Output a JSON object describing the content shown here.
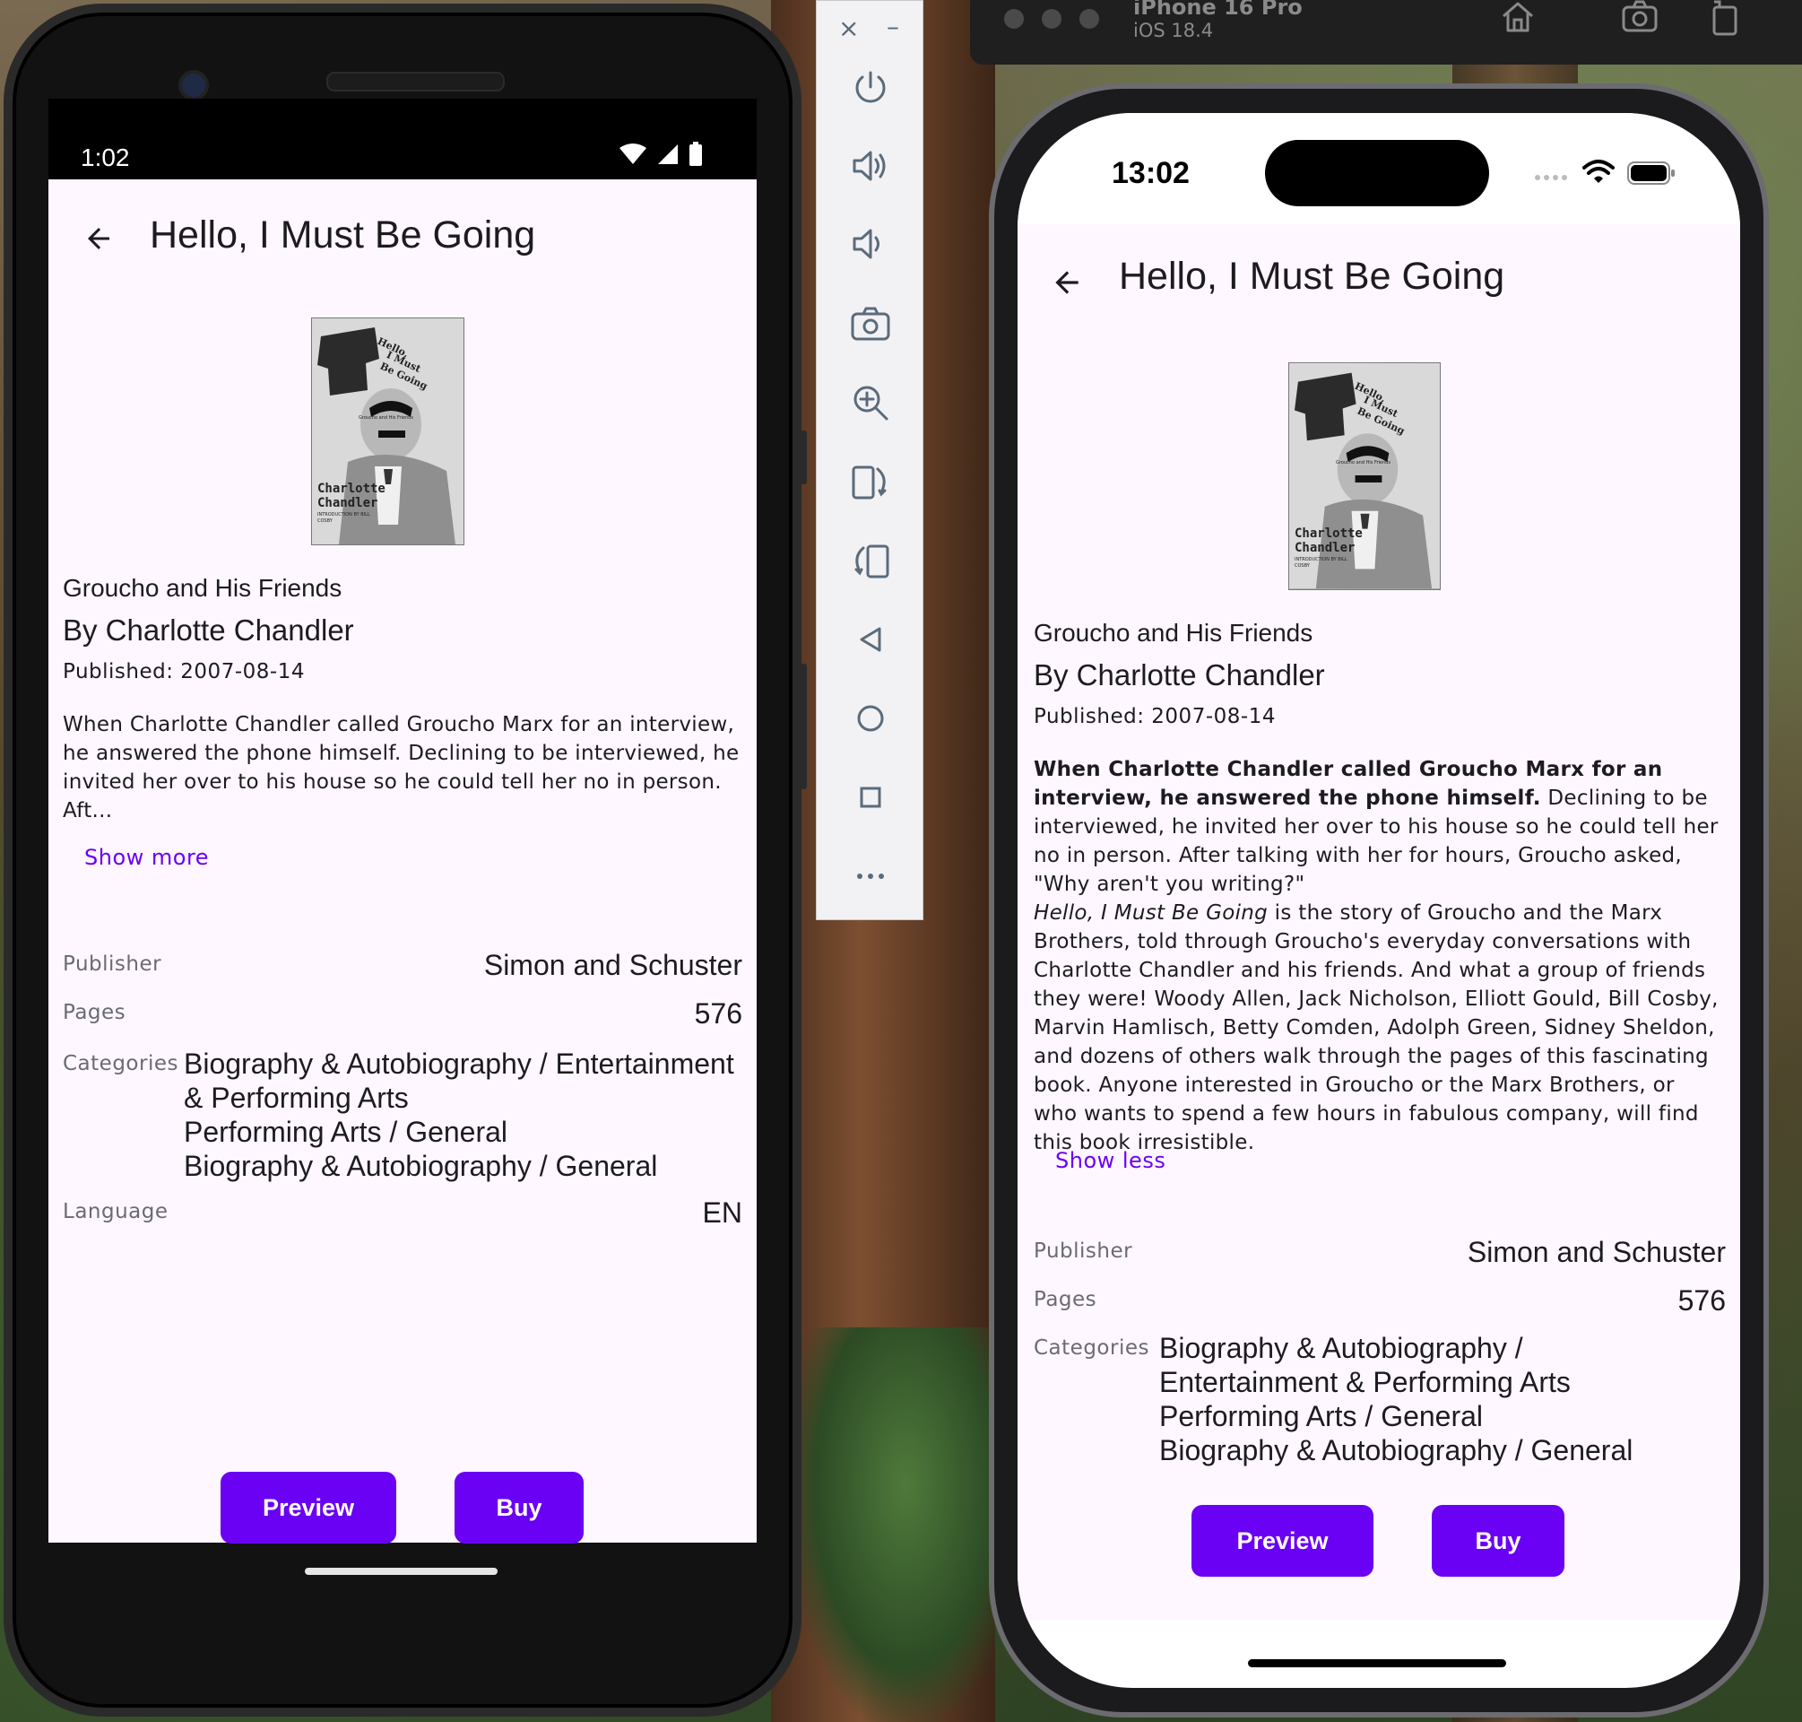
{
  "colors": {
    "accent": "#6a00f4",
    "screen_bg": "#fef7ff"
  },
  "android": {
    "status": {
      "time": "1:02"
    },
    "appbar": {
      "title": "Hello, I Must Be Going",
      "back_icon": "arrow-left-icon"
    },
    "book": {
      "subtitle": "Groucho and His Friends",
      "author": "By Charlotte Chandler",
      "published": "Published: 2007-08-14",
      "description": "When Charlotte Chandler called Groucho Marx for an interview, he answered the phone himself. Declining to be interviewed, he invited her over to his house so he could tell her no in person. Aft...",
      "toggle": "Show more"
    },
    "details": {
      "publisher_label": "Publisher",
      "publisher_value": "Simon and Schuster",
      "pages_label": "Pages",
      "pages_value": "576",
      "categories_label": "Categories",
      "categories_1": "Biography & Autobiography / Entertainment & Performing Arts",
      "categories_2": "Performing Arts / General",
      "categories_3": "Biography & Autobiography / General",
      "language_label": "Language",
      "language_value": "EN"
    },
    "buttons": {
      "preview": "Preview",
      "buy": "Buy"
    }
  },
  "emulator_toolbar": {
    "close": "×",
    "minimize": "–",
    "icons": [
      "power-icon",
      "volume-up-icon",
      "volume-down-icon",
      "camera-icon",
      "zoom-in-icon",
      "rotate-left-icon",
      "rotate-right-icon",
      "back-triangle-icon",
      "home-circle-icon",
      "overview-square-icon",
      "more-icon"
    ]
  },
  "simulator": {
    "title": "iPhone 16 Pro",
    "os": "iOS 18.4",
    "tools": [
      "home-icon",
      "screenshot-icon",
      "rotate-icon"
    ]
  },
  "iphone": {
    "status": {
      "time": "13:02"
    },
    "appbar": {
      "title": "Hello, I Must Be Going"
    },
    "book": {
      "subtitle": "Groucho and His Friends",
      "author": "By Charlotte Chandler",
      "published": "Published: 2007-08-14",
      "desc_bold": "When Charlotte Chandler called Groucho Marx for an interview, he answered the phone himself.",
      "desc_rest": " Declining to be interviewed, he invited her over to his house so he could tell her no in person. After talking with her for hours, Groucho asked, \"Why aren't you writing?\"",
      "desc2_italic": "Hello, I Must Be Going",
      "desc2_rest": " is the story of Groucho and the Marx Brothers, told through Groucho's everyday conversations with Charlotte Chandler and his friends. And what a group of friends they were! Woody Allen, Jack Nicholson, Elliott Gould, Bill Cosby, Marvin Hamlisch, Betty Comden, Adolph Green, Sidney Sheldon, and dozens of others walk through the pages of this fascinating book. Anyone interested in Groucho or the Marx Brothers, or who wants to spend a few hours in fabulous company, will find this book irresistible.",
      "toggle": "Show less"
    },
    "details": {
      "publisher_label": "Publisher",
      "publisher_value": "Simon and Schuster",
      "pages_label": "Pages",
      "pages_value": "576",
      "categories_label": "Categories",
      "categories_1": "Biography & Autobiography /",
      "categories_1b": "Entertainment & Performing Arts",
      "categories_2": "Performing Arts / General",
      "categories_3": "Biography & Autobiography / General"
    },
    "buttons": {
      "preview": "Preview",
      "buy": "Buy"
    }
  },
  "cover": {
    "title_line1": "Hello,",
    "title_line2": "I Must",
    "title_line3": "Be Going",
    "tagline": "Groucho and His Friends",
    "author_line1": "Charlotte",
    "author_line2": "Chandler",
    "intro": "INTRODUCTION BY BILL COSBY"
  }
}
